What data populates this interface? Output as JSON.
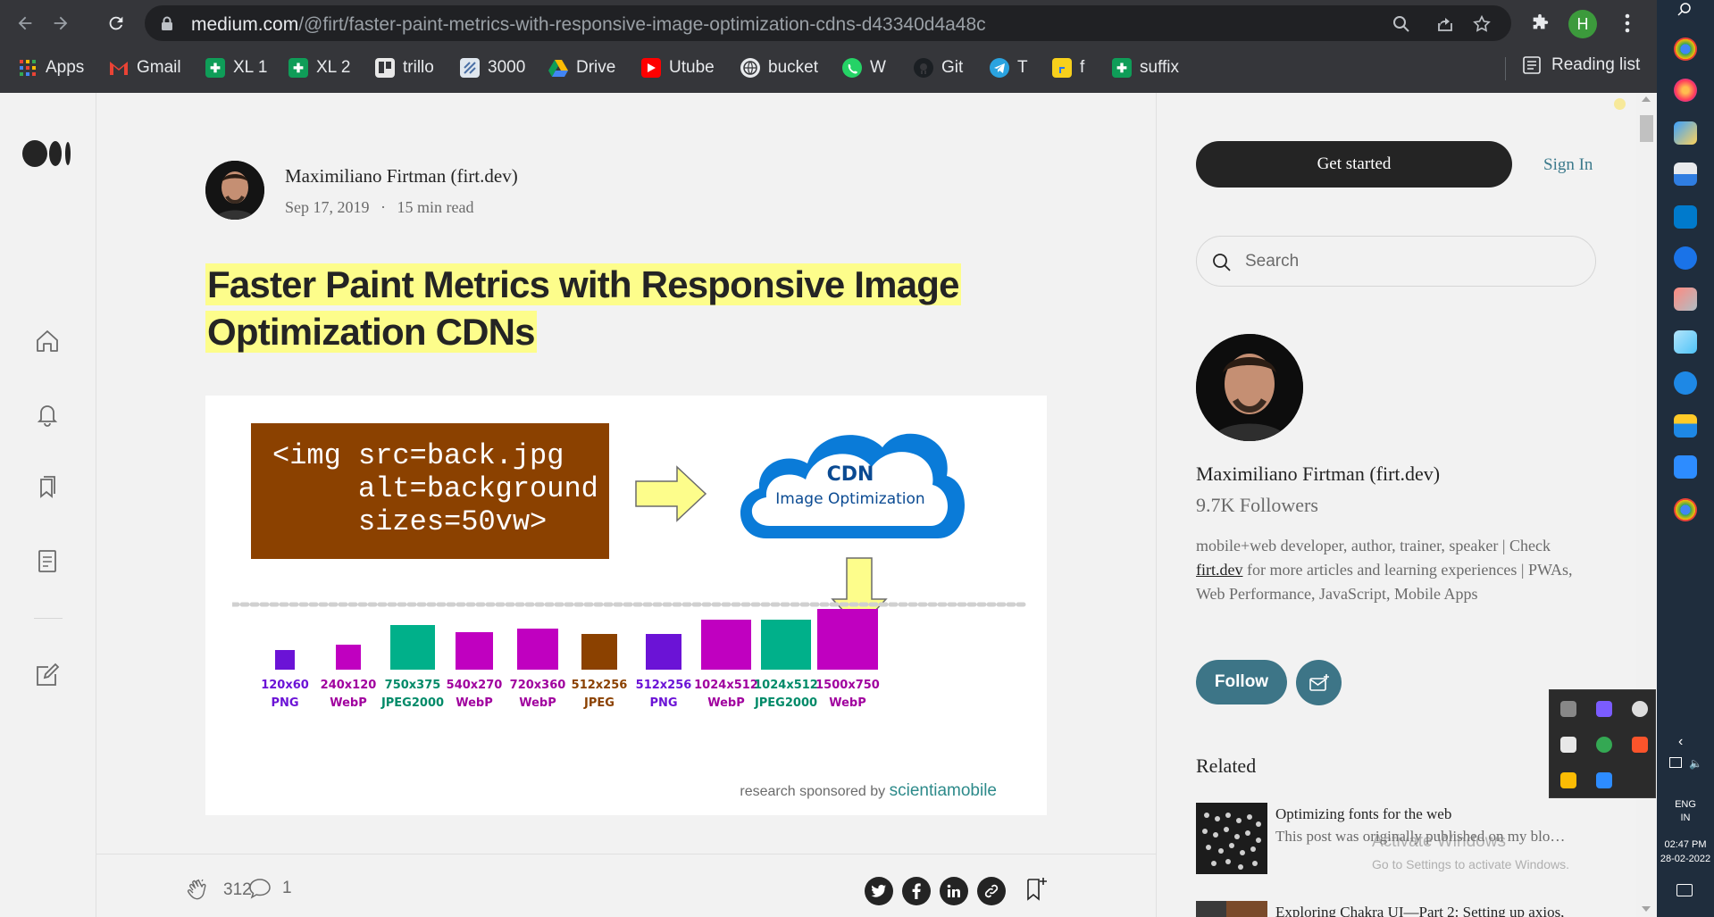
{
  "browser": {
    "url_domain": "medium.com",
    "url_path": "/@firt/faster-paint-metrics-with-responsive-image-optimization-cdns-d43340d4a48c",
    "profile_initial": "H",
    "bookmarks": [
      {
        "label": "Apps",
        "icon": "apps-grid-icon",
        "color": "#e94235"
      },
      {
        "label": "Gmail",
        "icon": "gmail-icon",
        "color": "#ea4335"
      },
      {
        "label": "XL 1",
        "icon": "sheets-icon",
        "color": "#0f9d58"
      },
      {
        "label": "XL 2",
        "icon": "sheets-icon",
        "color": "#0f9d58"
      },
      {
        "label": "trillo",
        "icon": "trello-icon",
        "color": "#e8e8e8"
      },
      {
        "label": "3000",
        "icon": "site-icon",
        "color": "#4a6fa5"
      },
      {
        "label": "Drive",
        "icon": "drive-icon",
        "color": "#fbbc04"
      },
      {
        "label": "Utube",
        "icon": "youtube-icon",
        "color": "#ff0000"
      },
      {
        "label": "bucket",
        "icon": "globe-icon",
        "color": "#e8eaed"
      },
      {
        "label": "W",
        "icon": "whatsapp-icon",
        "color": "#25d366"
      },
      {
        "label": "Git",
        "icon": "github-icon",
        "color": "#1b1f23"
      },
      {
        "label": "T",
        "icon": "telegram-icon",
        "color": "#2aa3e0"
      },
      {
        "label": "f",
        "icon": "flipkart-icon",
        "color": "#f7d01c"
      },
      {
        "label": "suffix",
        "icon": "sheets-icon",
        "color": "#0f9d58"
      }
    ],
    "reading_list": "Reading list"
  },
  "article": {
    "author": "Maximiliano Firtman (firt.dev)",
    "date": "Sep 17, 2019",
    "separator": "·",
    "read_time": "15 min read",
    "title_line1": "Faster Paint Metrics with Responsive Image",
    "title_line2": "Optimization CDNs",
    "hero": {
      "code_lines": [
        "<img src=back.jpg",
        "     alt=background",
        "     sizes=50vw>"
      ],
      "cdn_title": "CDN",
      "cdn_subtitle": "Image Optimization",
      "variants": [
        {
          "size": "120x60",
          "format": "PNG",
          "color": "#6b13d6",
          "text_color": "#6b13d6"
        },
        {
          "size": "240x120",
          "format": "WebP",
          "color": "#c000c0",
          "text_color": "#a0009e"
        },
        {
          "size": "750x375",
          "format": "JPEG2000",
          "color": "#00b08a",
          "text_color": "#008a68"
        },
        {
          "size": "540x270",
          "format": "WebP",
          "color": "#c000c0",
          "text_color": "#a0009e"
        },
        {
          "size": "720x360",
          "format": "WebP",
          "color": "#c000c0",
          "text_color": "#a0009e"
        },
        {
          "size": "512x256",
          "format": "JPEG",
          "color": "#8b4100",
          "text_color": "#8b4100"
        },
        {
          "size": "512x256",
          "format": "PNG",
          "color": "#6b13d6",
          "text_color": "#6b13d6"
        },
        {
          "size": "1024x512",
          "format": "WebP",
          "color": "#c000c0",
          "text_color": "#a0009e"
        },
        {
          "size": "1024x512",
          "format": "JPEG2000",
          "color": "#00b08a",
          "text_color": "#008a68"
        },
        {
          "size": "1500x750",
          "format": "WebP",
          "color": "#c000c0",
          "text_color": "#a0009e"
        }
      ],
      "sponsor_prefix": "research sponsored by",
      "sponsor_name": "scientiamobile"
    },
    "claps": "312",
    "comments": "1"
  },
  "sidebar": {
    "get_started": "Get started",
    "sign_in": "Sign In",
    "search_placeholder": "Search",
    "profile_name": "Maximiliano Firtman (firt.dev)",
    "followers": "9.7K Followers",
    "bio_part1": "mobile+web developer, author, trainer, speaker | Check ",
    "bio_link": "firt.dev",
    "bio_part2": " for more articles and learning experiences | PWAs, Web Performance, JavaScript, Mobile Apps",
    "follow": "Follow",
    "related_heading": "Related",
    "related": [
      {
        "title": "Optimizing fonts for the web",
        "snippet": "This post was originally published on my blo…"
      },
      {
        "title": "Exploring Chakra UI—Part 2: Setting up axios,",
        "snippet": ""
      }
    ],
    "activate_title": "Activate Windows",
    "activate_sub": "Go to Settings to activate Windows."
  },
  "taskbar": {
    "lang": "ENG",
    "region": "IN",
    "time": "02:47 PM",
    "date": "28-02-2022"
  }
}
